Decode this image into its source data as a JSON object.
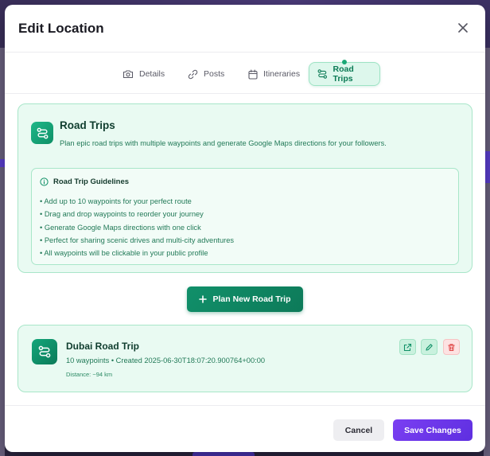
{
  "modal": {
    "title": "Edit Location"
  },
  "tabs": [
    {
      "label": "Details",
      "icon": "camera-icon"
    },
    {
      "label": "Posts",
      "icon": "link-icon"
    },
    {
      "label": "Itineraries",
      "icon": "calendar-icon"
    },
    {
      "label": "Road Trips",
      "icon": "route-icon",
      "active": true
    }
  ],
  "intro": {
    "title": "Road Trips",
    "description": "Plan epic road trips with multiple waypoints and generate Google Maps directions for your followers.",
    "guidelines": {
      "title": "Road Trip Guidelines",
      "items": [
        "• Add up to 10 waypoints for your perfect route",
        "• Drag and drop waypoints to reorder your journey",
        "• Generate Google Maps directions with one click",
        "• Perfect for sharing scenic drives and multi-city adventures",
        "• All waypoints will be clickable in your public profile"
      ]
    }
  },
  "plan_button": {
    "label": "Plan New Road Trip",
    "icon": "plus-icon"
  },
  "trips": [
    {
      "name": "Dubai Road Trip",
      "meta": "10 waypoints • Created 2025-06-30T18:07:20.900764+00:00",
      "distance": "Distance: ~94 km",
      "actions": [
        "external-link-icon",
        "edit-icon",
        "trash-icon"
      ]
    }
  ],
  "footer": {
    "cancel_label": "Cancel",
    "save_label": "Save Changes"
  },
  "colors": {
    "accent_green": "#0d7a59",
    "accent_purple": "#6a35e8",
    "danger": "#e04848"
  }
}
